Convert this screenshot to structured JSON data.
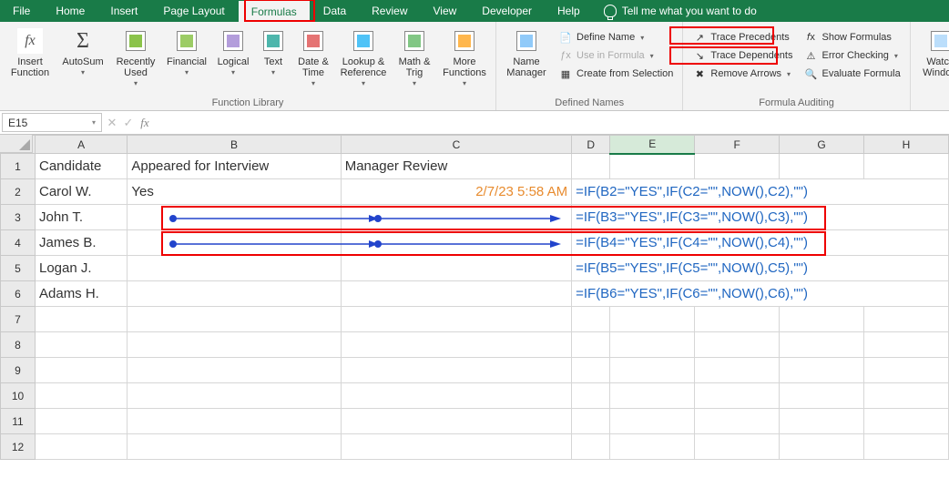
{
  "tabs": [
    "File",
    "Home",
    "Insert",
    "Page Layout",
    "Formulas",
    "Data",
    "Review",
    "View",
    "Developer",
    "Help"
  ],
  "active_tab": "Formulas",
  "tell_me": "Tell me what you want to do",
  "ribbon": {
    "insert_function": "Insert\nFunction",
    "autosum": "AutoSum",
    "recently_used": "Recently\nUsed",
    "financial": "Financial",
    "logical": "Logical",
    "text": "Text",
    "date_time": "Date &\nTime",
    "lookup_ref": "Lookup &\nReference",
    "math_trig": "Math &\nTrig",
    "more_functions": "More\nFunctions",
    "group_function_library": "Function Library",
    "name_manager": "Name\nManager",
    "define_name": "Define Name",
    "use_in_formula": "Use in Formula",
    "create_from_selection": "Create from Selection",
    "group_defined_names": "Defined Names",
    "trace_precedents": "Trace Precedents",
    "trace_dependents": "Trace Dependents",
    "remove_arrows": "Remove Arrows",
    "show_formulas": "Show Formulas",
    "error_checking": "Error Checking",
    "evaluate_formula": "Evaluate Formula",
    "group_formula_auditing": "Formula Auditing",
    "watch_window": "Watch\nWindow"
  },
  "namebox": "E15",
  "columns": [
    "A",
    "B",
    "C",
    "D",
    "E",
    "F",
    "G",
    "H"
  ],
  "rows": [
    "1",
    "2",
    "3",
    "4",
    "5",
    "6",
    "7",
    "8",
    "9",
    "10",
    "11",
    "12"
  ],
  "headers": {
    "A": "Candidate",
    "B": "Appeared for Interview",
    "C": "Manager Review"
  },
  "data": {
    "r2": {
      "A": "Carol W.",
      "B": "Yes",
      "C": "2/7/23 5:58 AM",
      "D": "=IF(B2=\"YES\",IF(C2=\"\",NOW(),C2),\"\")"
    },
    "r3": {
      "A": "John T.",
      "D": "=IF(B3=\"YES\",IF(C3=\"\",NOW(),C3),\"\")"
    },
    "r4": {
      "A": "James B.",
      "D": "=IF(B4=\"YES\",IF(C4=\"\",NOW(),C4),\"\")"
    },
    "r5": {
      "A": "Logan J.",
      "D": "=IF(B5=\"YES\",IF(C5=\"\",NOW(),C5),\"\")"
    },
    "r6": {
      "A": "Adams H.",
      "D": "=IF(B6=\"YES\",IF(C6=\"\",NOW(),C6),\"\")"
    }
  },
  "selected_cell": "E15",
  "highlight": {
    "tab_formulas": true,
    "trace_buttons": true,
    "rows_3_4": true
  }
}
